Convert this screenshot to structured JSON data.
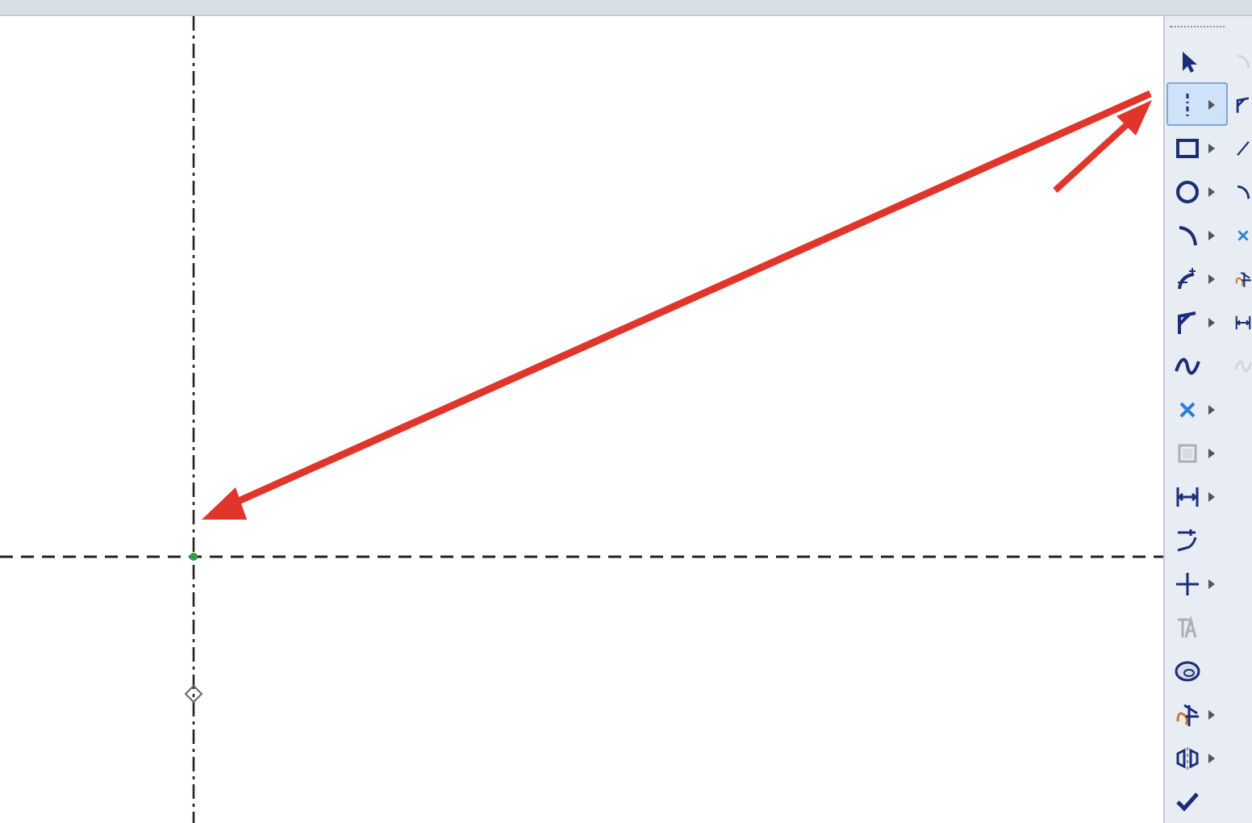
{
  "toolbar": {
    "tools": [
      {
        "kind": "select",
        "selected": false,
        "disabled": false,
        "has_menu": false
      },
      {
        "kind": "centerline",
        "selected": true,
        "disabled": false,
        "has_menu": true
      },
      {
        "kind": "rectangle",
        "selected": false,
        "disabled": false,
        "has_menu": true
      },
      {
        "kind": "circle",
        "selected": false,
        "disabled": false,
        "has_menu": true
      },
      {
        "kind": "arc",
        "selected": false,
        "disabled": false,
        "has_menu": true
      },
      {
        "kind": "fillet",
        "selected": false,
        "disabled": false,
        "has_menu": true
      },
      {
        "kind": "chamfer",
        "selected": false,
        "disabled": false,
        "has_menu": true
      },
      {
        "kind": "spline",
        "selected": false,
        "disabled": false,
        "has_menu": false
      },
      {
        "kind": "point",
        "selected": false,
        "disabled": false,
        "has_menu": true
      },
      {
        "kind": "plane",
        "selected": false,
        "disabled": true,
        "has_menu": true
      },
      {
        "kind": "dimension",
        "selected": false,
        "disabled": false,
        "has_menu": true
      },
      {
        "kind": "offset",
        "selected": false,
        "disabled": false,
        "has_menu": false
      },
      {
        "kind": "cross",
        "selected": false,
        "disabled": false,
        "has_menu": true
      },
      {
        "kind": "text",
        "selected": false,
        "disabled": true,
        "has_menu": false
      },
      {
        "kind": "ellipse",
        "selected": false,
        "disabled": false,
        "has_menu": false
      },
      {
        "kind": "trim",
        "selected": false,
        "disabled": false,
        "has_menu": true
      },
      {
        "kind": "mirror",
        "selected": false,
        "disabled": false,
        "has_menu": true
      },
      {
        "kind": "check",
        "selected": false,
        "disabled": false,
        "has_menu": false
      }
    ]
  },
  "second_column": [
    {
      "kind": "arc",
      "disabled": true
    },
    {
      "kind": "chamfer",
      "disabled": false
    },
    {
      "kind": "line",
      "disabled": false
    },
    {
      "kind": "arc",
      "disabled": false
    },
    {
      "kind": "point",
      "disabled": false
    },
    {
      "kind": "trim",
      "disabled": false
    },
    {
      "kind": "dimension",
      "disabled": false
    },
    {
      "kind": "spline",
      "disabled": true
    }
  ]
}
